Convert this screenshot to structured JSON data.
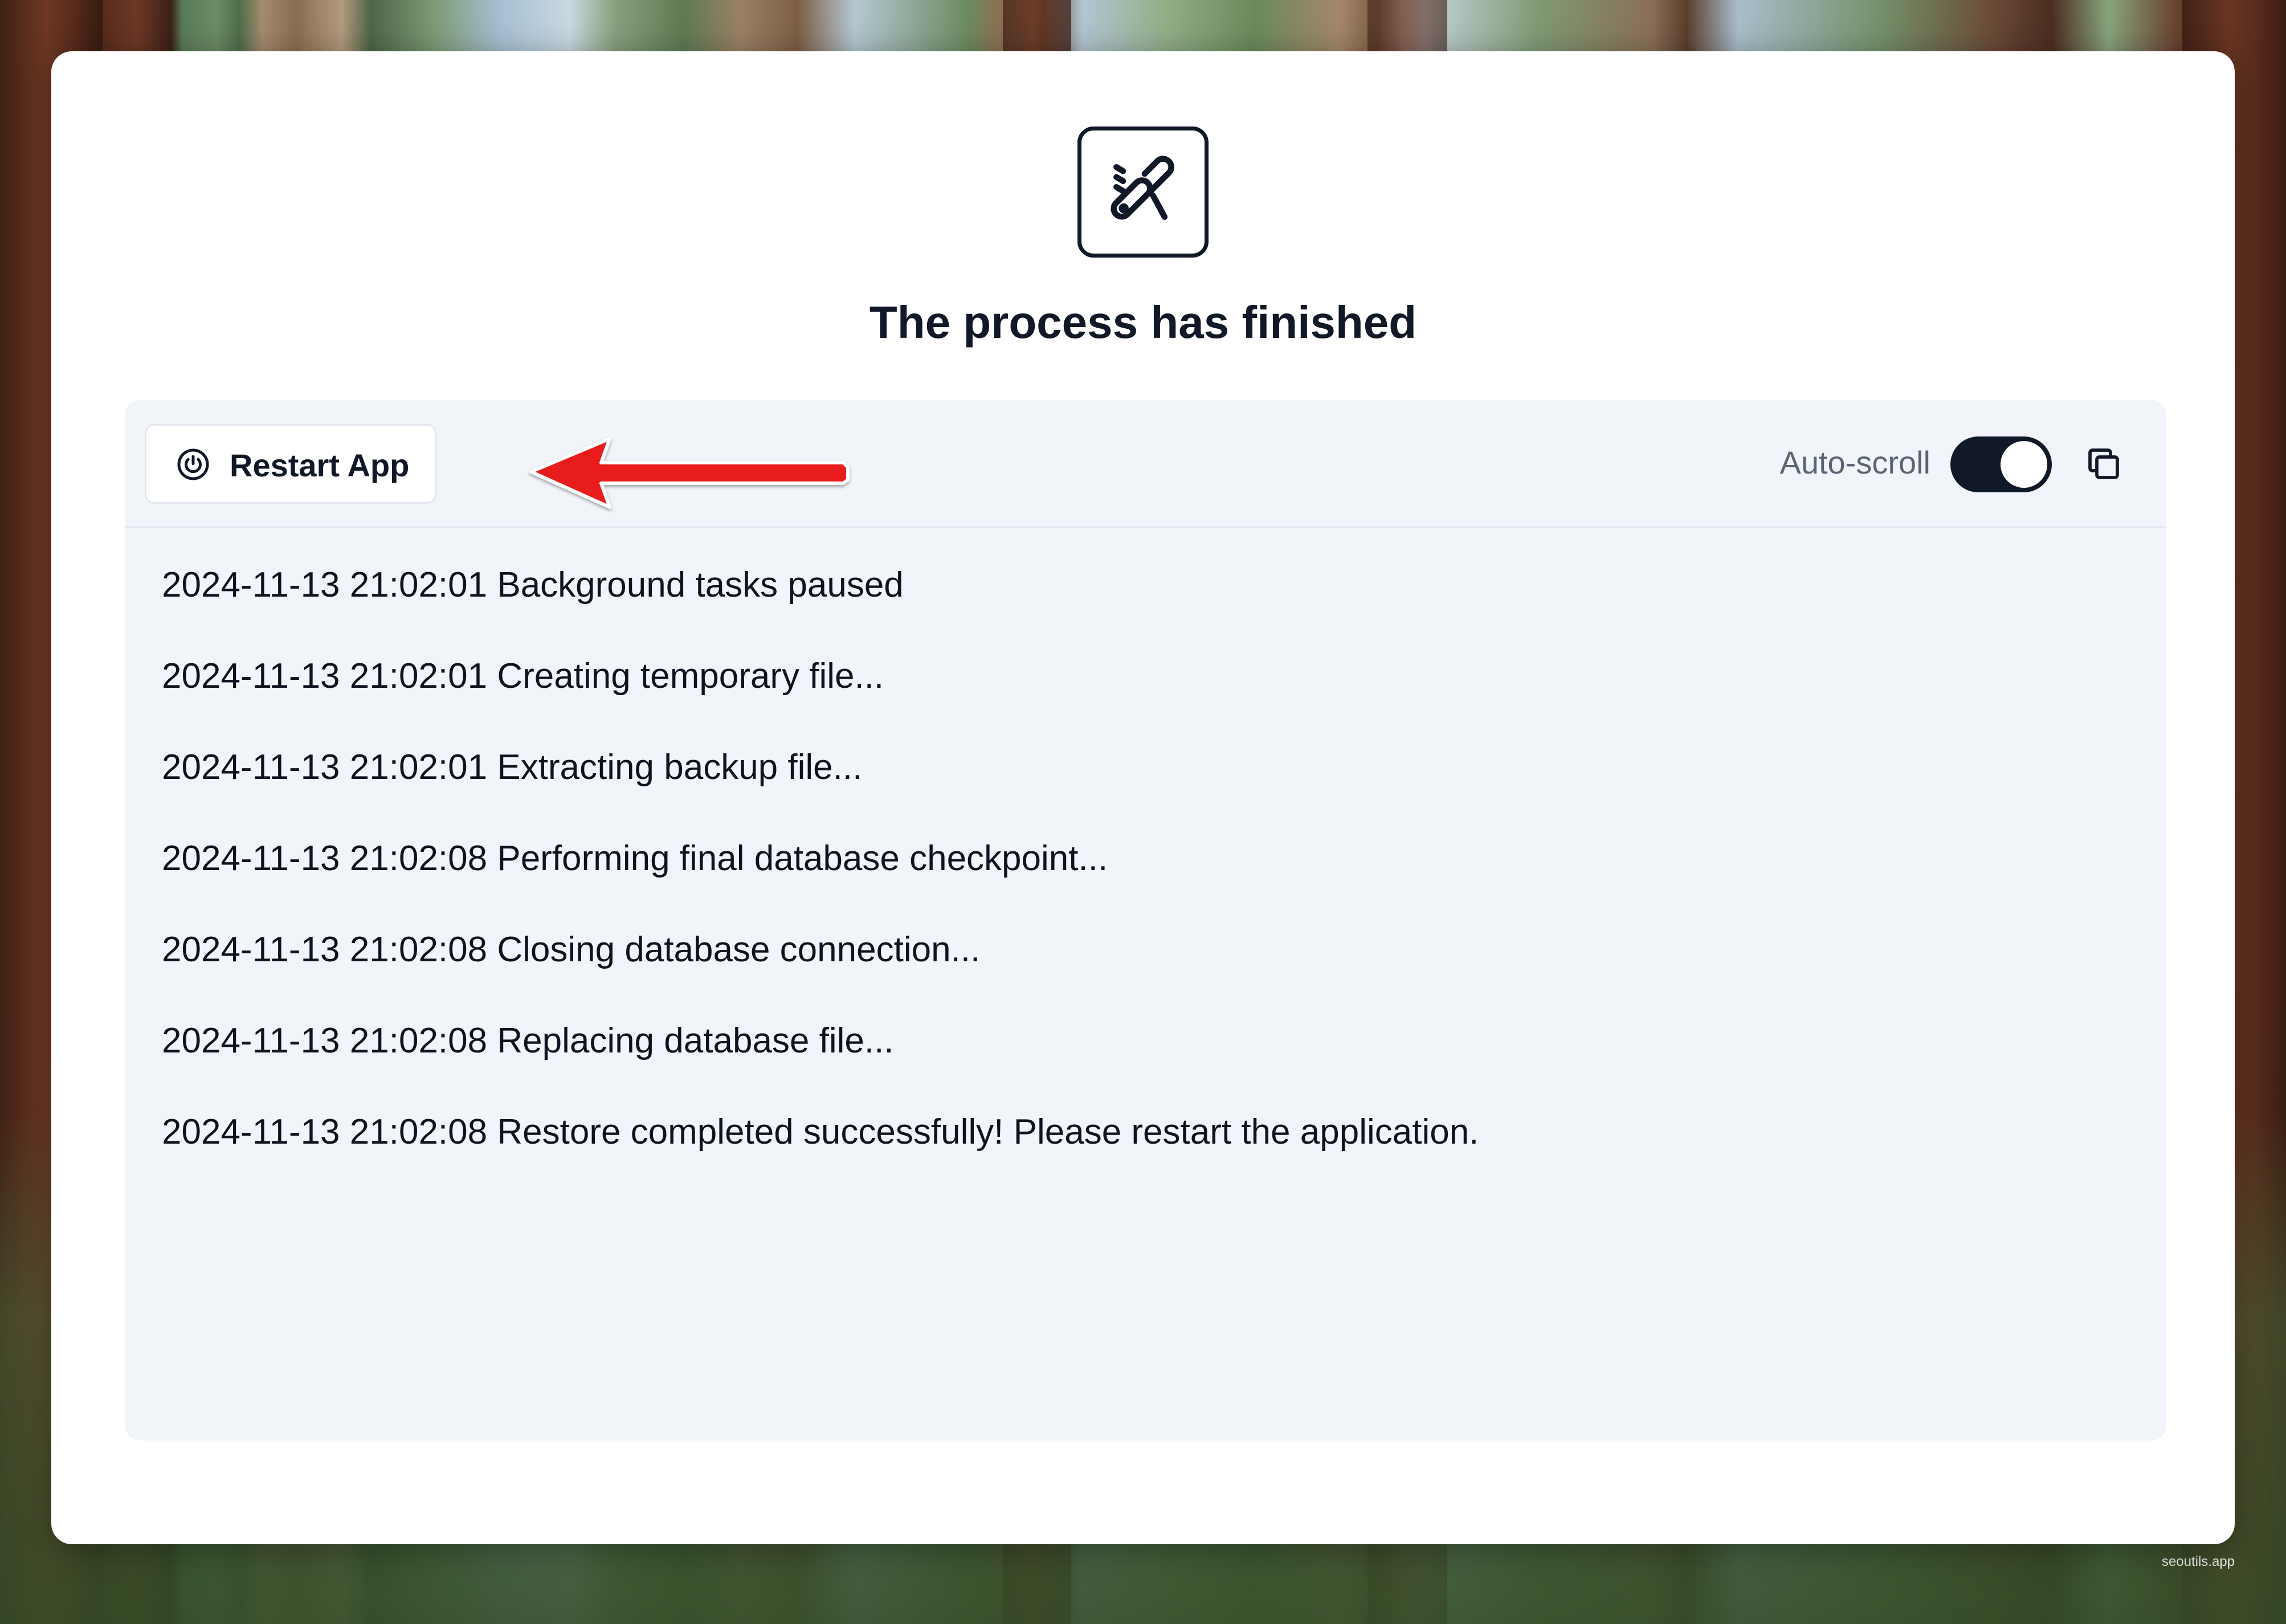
{
  "page": {
    "title": "The process has finished",
    "app_icon": "swiss-knife-icon",
    "watermark": "seoutils.app"
  },
  "toolbar": {
    "restart_label": "Restart App",
    "restart_icon": "power-icon",
    "autoscroll_label": "Auto-scroll",
    "autoscroll_on": true,
    "copy_icon": "copy-icon",
    "annotation_arrow_color": "#e81c1c"
  },
  "log": {
    "lines": [
      "2024-11-13 21:02:01 Background tasks paused",
      "2024-11-13 21:02:01 Creating temporary file...",
      "2024-11-13 21:02:01 Extracting backup file...",
      "2024-11-13 21:02:08 Performing final database checkpoint...",
      "2024-11-13 21:02:08 Closing database connection...",
      "2024-11-13 21:02:08 Replacing database file...",
      "2024-11-13 21:02:08 Restore completed successfully! Please restart the application."
    ]
  },
  "colors": {
    "accent": "#111827",
    "panel_background": "#f1f4f9",
    "muted_text": "#5b6475"
  }
}
